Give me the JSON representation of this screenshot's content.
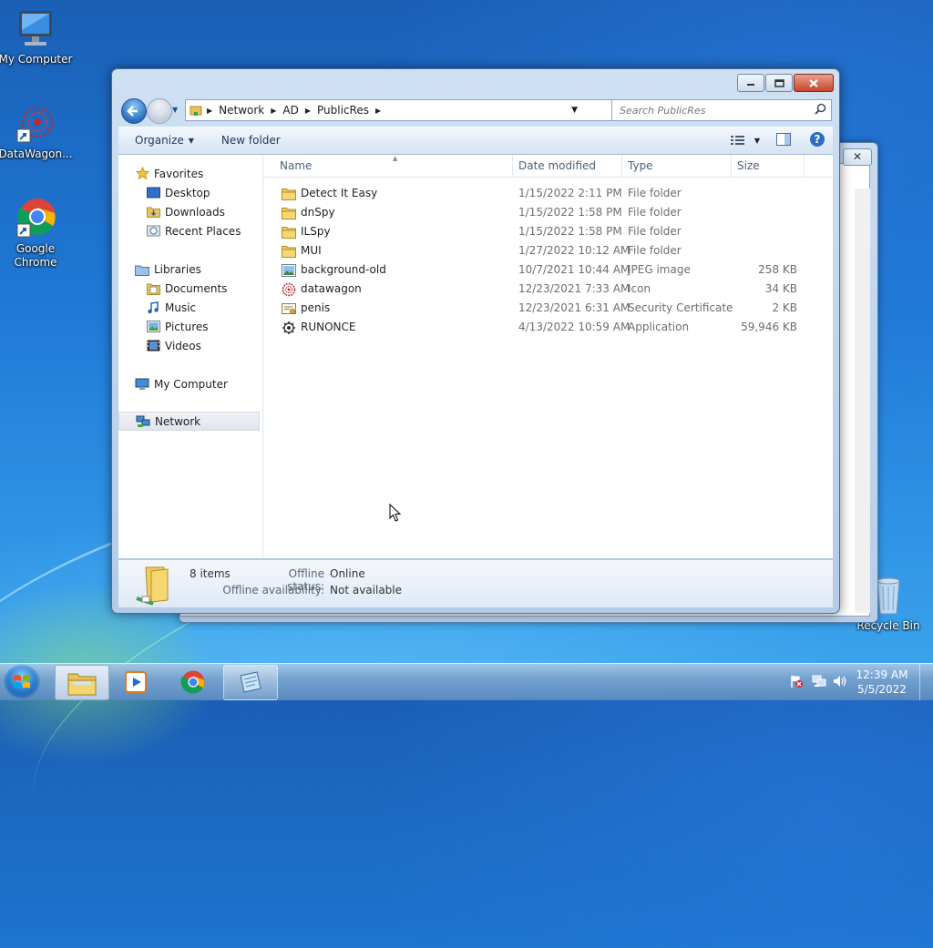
{
  "desktop": {
    "icons": [
      {
        "label": "My Computer"
      },
      {
        "label": "DataWagon..."
      },
      {
        "label": "Google Chrome"
      },
      {
        "label": "Recycle Bin"
      }
    ]
  },
  "window": {
    "address": {
      "crumbs": [
        "Network",
        "AD",
        "PublicRes"
      ]
    },
    "search": {
      "placeholder": "Search PublicRes"
    },
    "toolbar": {
      "organize": "Organize",
      "new_folder": "New folder"
    },
    "nav": {
      "favorites": "Favorites",
      "favorites_items": [
        "Desktop",
        "Downloads",
        "Recent Places"
      ],
      "libraries": "Libraries",
      "libraries_items": [
        "Documents",
        "Music",
        "Pictures",
        "Videos"
      ],
      "computer": "My Computer",
      "network": "Network"
    },
    "columns": {
      "name": "Name",
      "date": "Date modified",
      "type": "Type",
      "size": "Size"
    },
    "files": [
      {
        "name": "Detect It Easy",
        "date": "1/15/2022 2:11 PM",
        "type": "File folder",
        "size": "",
        "icon": "folder-icon"
      },
      {
        "name": "dnSpy",
        "date": "1/15/2022 1:58 PM",
        "type": "File folder",
        "size": "",
        "icon": "folder-icon"
      },
      {
        "name": "ILSpy",
        "date": "1/15/2022 1:58 PM",
        "type": "File folder",
        "size": "",
        "icon": "folder-icon"
      },
      {
        "name": "MUI",
        "date": "1/27/2022 10:12 AM",
        "type": "File folder",
        "size": "",
        "icon": "folder-icon"
      },
      {
        "name": "background-old",
        "date": "10/7/2021 10:44 AM",
        "type": "JPEG image",
        "size": "258 KB",
        "icon": "image-file-icon"
      },
      {
        "name": "datawagon",
        "date": "12/23/2021 7:33 AM",
        "type": "Icon",
        "size": "34 KB",
        "icon": "ico-file-icon"
      },
      {
        "name": "penis",
        "date": "12/23/2021 6:31 AM",
        "type": "Security Certificate",
        "size": "2 KB",
        "icon": "certificate-icon"
      },
      {
        "name": "RUNONCE",
        "date": "4/13/2022 10:59 AM",
        "type": "Application",
        "size": "59,946 KB",
        "icon": "application-icon"
      }
    ],
    "status": {
      "count": "8 items",
      "offline_status_label": "Offline status:",
      "offline_status_value": "Online",
      "offline_avail_label": "Offline availability:",
      "offline_avail_value": "Not available"
    }
  },
  "taskbar": {
    "time": "12:39 AM",
    "date": "5/5/2022"
  }
}
